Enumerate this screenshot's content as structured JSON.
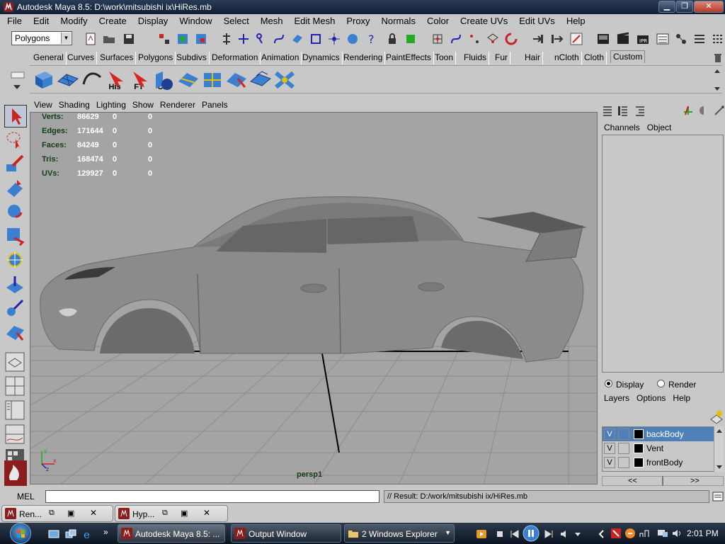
{
  "window": {
    "title": "Autodesk Maya 8.5: D:\\work\\mitsubishi ix\\HiRes.mb",
    "minimize": "▁",
    "restore": "❐",
    "close": "✕"
  },
  "menubar": [
    "File",
    "Edit",
    "Modify",
    "Create",
    "Display",
    "Window",
    "Select",
    "Mesh",
    "Edit Mesh",
    "Proxy",
    "Normals",
    "Color",
    "Create UVs",
    "Edit UVs",
    "Help"
  ],
  "statusline": {
    "mode": "Polygons"
  },
  "shelf": {
    "tabs": [
      "General",
      "Curves",
      "Surfaces",
      "Polygons",
      "Subdivs",
      "Deformation",
      "Animation",
      "Dynamics",
      "Rendering",
      "PaintEffects",
      "Toon",
      "Fluids",
      "Fur",
      "Hair",
      "nCloth",
      "Cloth",
      "Custom"
    ],
    "active_tab": "Custom",
    "buttons": [
      "",
      "",
      "His",
      "FT",
      "CP",
      "",
      "",
      "",
      "",
      "",
      ""
    ]
  },
  "viewport": {
    "menu": [
      "View",
      "Shading",
      "Lighting",
      "Show",
      "Renderer",
      "Panels"
    ],
    "hud": [
      {
        "label": "Verts:",
        "v1": "86629",
        "v2": "0",
        "v3": "0"
      },
      {
        "label": "Edges:",
        "v1": "171644",
        "v2": "0",
        "v3": "0"
      },
      {
        "label": "Faces:",
        "v1": "84249",
        "v2": "0",
        "v3": "0"
      },
      {
        "label": "Tris:",
        "v1": "168474",
        "v2": "0",
        "v3": "0"
      },
      {
        "label": "UVs:",
        "v1": "129927",
        "v2": "0",
        "v3": "0"
      }
    ],
    "camera": "persp1",
    "axis": {
      "x": "x",
      "y": "y",
      "z": "z"
    }
  },
  "channelbox": {
    "tabs": [
      "Channels",
      "Object"
    ],
    "display_radio": "Display",
    "render_radio": "Render",
    "layer_menu": [
      "Layers",
      "Options",
      "Help"
    ],
    "layers": [
      {
        "v": "V",
        "name": "backBody",
        "selected": true
      },
      {
        "v": "V",
        "name": "Vent",
        "selected": false
      },
      {
        "v": "V",
        "name": "frontBody",
        "selected": false
      }
    ],
    "scroll_left": "<<",
    "scroll_right": ">>"
  },
  "commandline": {
    "label": "MEL",
    "result": "// Result: D:/work/mitsubishi ix/HiRes.mb"
  },
  "minimized": [
    {
      "title": "Ren..."
    },
    {
      "title": "Hyp..."
    }
  ],
  "taskbar": {
    "items": [
      {
        "title": "Autodesk Maya 8.5: ..."
      },
      {
        "title": "Output Window"
      },
      {
        "title": "2 Windows Explorer"
      }
    ],
    "more": "»",
    "clock": "2:01 PM"
  },
  "colors": {
    "accent": "#4f7fb8",
    "hud_label": "#123d17",
    "viewport_bg": "#a4a4a4"
  }
}
